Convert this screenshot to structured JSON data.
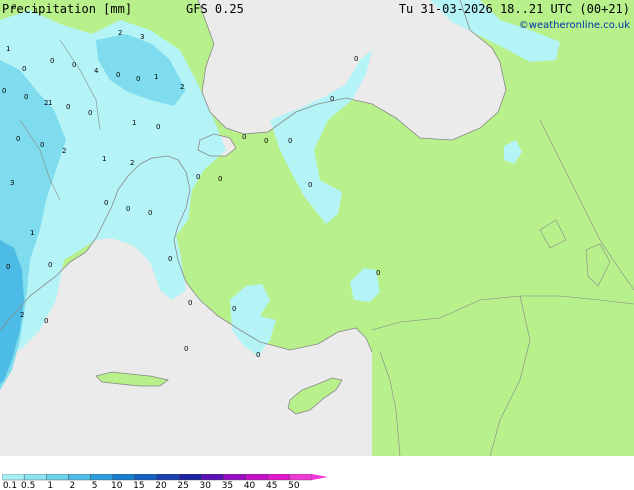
{
  "legend": {
    "title": "Precipitation [mm]",
    "model": "GFS 0.25",
    "ticks": [
      "0.1",
      "0.5",
      "1",
      "2",
      "5",
      "10",
      "15",
      "20",
      "25",
      "30",
      "35",
      "40",
      "45",
      "50"
    ],
    "colors": [
      "#a9f0f5",
      "#8de4f0",
      "#6dd1ec",
      "#4ebce6",
      "#2e9fdb",
      "#1a7ecf",
      "#1560c0",
      "#1742b0",
      "#1a24a0",
      "#5a12b4",
      "#9b0fc4",
      "#c50fc8",
      "#e01acc",
      "#f03ad8"
    ]
  },
  "header": {
    "valid_time": "Tu 31-03-2026 18..21 UTC (00+21)",
    "credit": "©weatheronline.co.uk"
  },
  "map": {
    "colors": {
      "land": "#b8f08c",
      "sea": "#ebebeb",
      "coast": "#888888",
      "precip_light": "#b4f4f6",
      "precip_mid": "#7fdcee",
      "precip_heavy": "#4cbce6"
    },
    "point_values": [
      "0",
      "1",
      "2",
      "3",
      "4",
      "0",
      "1",
      "0",
      "0",
      "0",
      "1",
      "2",
      "0",
      "0",
      "1",
      "0",
      "0",
      "2",
      "0",
      "0",
      "0",
      "1",
      "2",
      "3",
      "0",
      "0",
      "0",
      "1",
      "2",
      "0",
      "0",
      "0",
      "0",
      "0",
      "0",
      "0",
      "0",
      "0",
      "1",
      "2",
      "0",
      "0",
      "0",
      "0",
      "0",
      "0",
      "0",
      "0",
      "0"
    ]
  }
}
